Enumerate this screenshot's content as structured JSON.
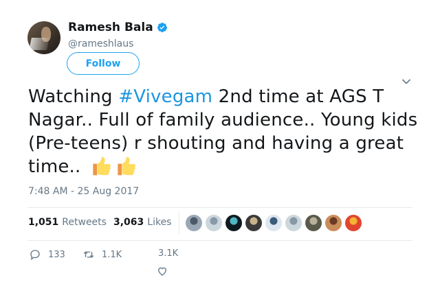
{
  "author": {
    "name": "Ramesh Bala",
    "handle": "@rameshlaus",
    "verified": true,
    "follow_label": "Follow"
  },
  "tweet": {
    "text_before": "Watching ",
    "hashtag": "#Vivegam",
    "text_after": " 2nd time at AGS T Nagar.. Full of family audience.. Young kids (Pre-teens) r shouting and having a great time.. ",
    "emoji": [
      "thumbs-up-emoji",
      "thumbs-up-emoji"
    ],
    "timestamp": "7:48 AM - 25 Aug 2017"
  },
  "stats": {
    "retweets_count": "1,051",
    "retweets_label": "Retweets",
    "likes_count": "3,063",
    "likes_label": "Likes"
  },
  "liker_avatars": [
    {
      "name": "liker-avatar-1",
      "colors": [
        "#9aa7b5",
        "#4b5a66"
      ]
    },
    {
      "name": "liker-avatar-2",
      "colors": [
        "#ccd6dd",
        "#8899a6"
      ]
    },
    {
      "name": "liker-avatar-3",
      "colors": [
        "#0e1a20",
        "#4fb6c4"
      ]
    },
    {
      "name": "liker-avatar-4",
      "colors": [
        "#3a3a3a",
        "#c9b28a"
      ]
    },
    {
      "name": "liker-avatar-5",
      "colors": [
        "#dde6ee",
        "#3c5a7a"
      ]
    },
    {
      "name": "liker-avatar-6",
      "colors": [
        "#ccd6dd",
        "#8899a6"
      ]
    },
    {
      "name": "liker-avatar-7",
      "colors": [
        "#5a5a4a",
        "#b8b09a"
      ]
    },
    {
      "name": "liker-avatar-8",
      "colors": [
        "#c98d5a",
        "#6a3a22"
      ]
    },
    {
      "name": "liker-avatar-9",
      "colors": [
        "#e0452f",
        "#f5b431"
      ]
    }
  ],
  "actions": {
    "reply_count": "133",
    "retweet_count": "1.1K",
    "like_count": "3.1K"
  },
  "colors": {
    "accent": "#1da1f2",
    "hashtag": "#1b95e0",
    "secondary_text": "#657786",
    "divider": "#e6ecf0"
  }
}
